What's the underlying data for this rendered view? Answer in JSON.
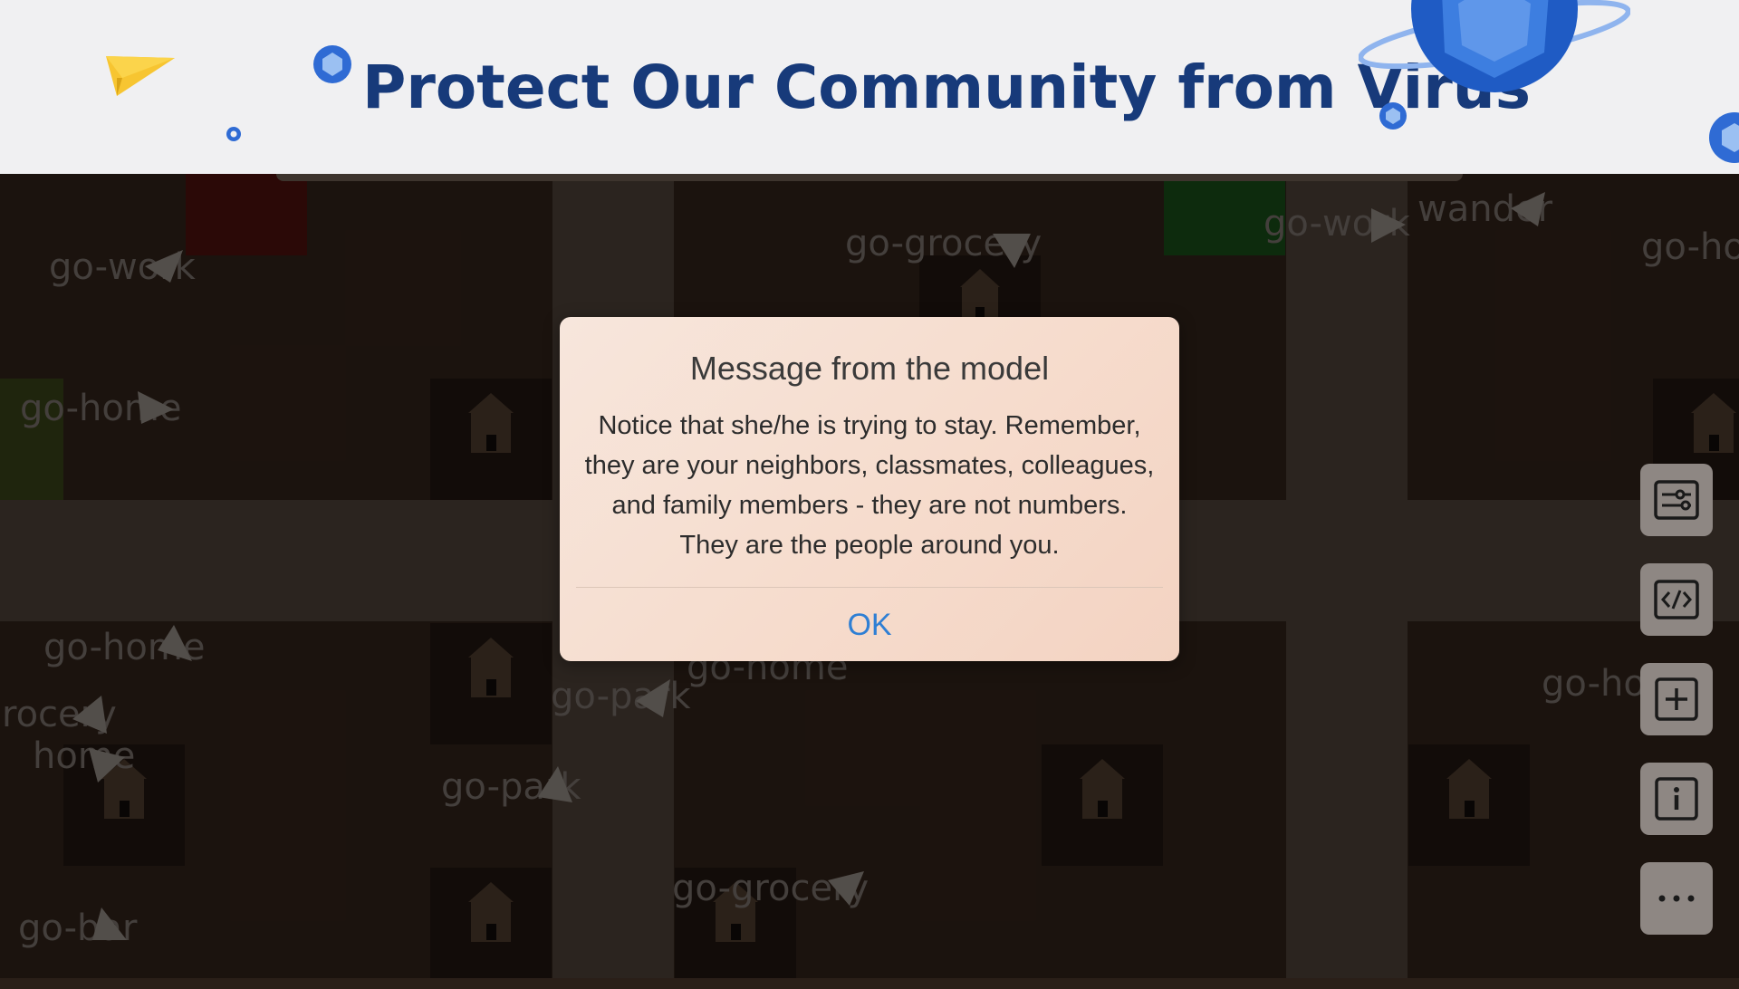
{
  "header": {
    "title": "Protect Our Community from Virus"
  },
  "dialog": {
    "title": "Message from the model",
    "body_lines": [
      "Notice that she/he is trying to stay. Remember,",
      "they are your neighbors, classmates, colleagues,",
      "and family members - they are not numbers.",
      "They are the people around you."
    ],
    "ok_label": "OK"
  },
  "agents": [
    {
      "label": "go-work"
    },
    {
      "label": "go-grocery"
    },
    {
      "label": "go-work"
    },
    {
      "label": "wander"
    },
    {
      "label": "go-ho"
    },
    {
      "label": "go-home"
    },
    {
      "label": "go-home"
    },
    {
      "label": "go-home"
    },
    {
      "label": "go-park"
    },
    {
      "label": "rocery"
    },
    {
      "label": "home"
    },
    {
      "label": "go-park"
    },
    {
      "label": "go-ho"
    },
    {
      "label": "go-grocery"
    },
    {
      "label": "go-bar"
    }
  ],
  "toolbar": {
    "buttons": [
      {
        "icon": "settings-sliders-icon"
      },
      {
        "icon": "code-icon"
      },
      {
        "icon": "add-icon"
      },
      {
        "icon": "info-icon"
      },
      {
        "icon": "more-icon"
      }
    ]
  },
  "colors": {
    "title": "#173a7a",
    "ok_link": "#2f7fd4",
    "dialog_bg": "#f6dccd",
    "board_bg": "#251a13"
  }
}
